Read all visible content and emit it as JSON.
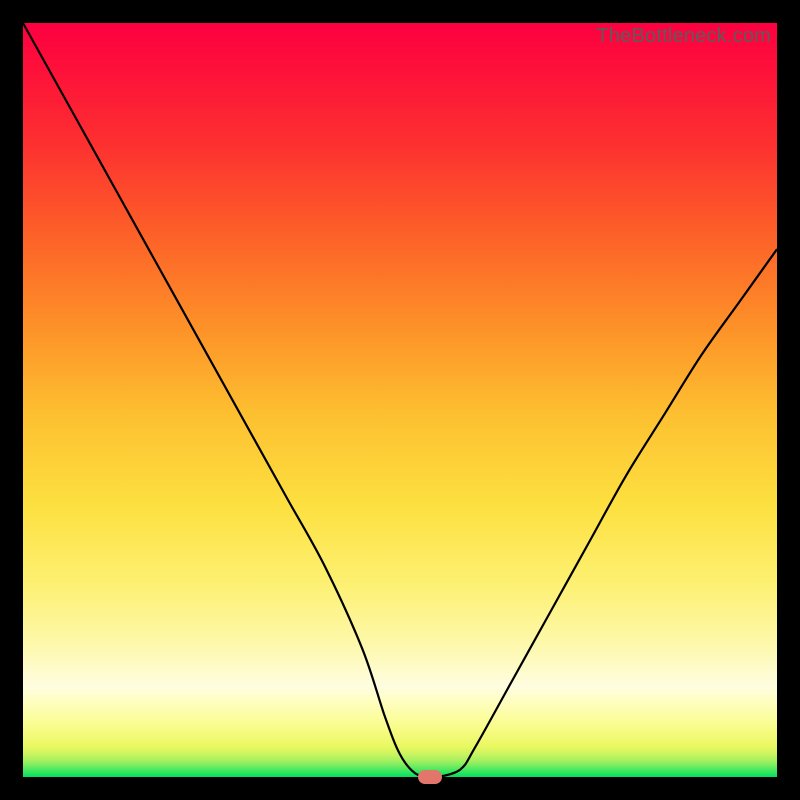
{
  "watermark": "TheBottleneck.com",
  "colors": {
    "frame": "#000000",
    "curve": "#000000",
    "marker": "#e2766a"
  },
  "chart_data": {
    "type": "line",
    "title": "",
    "xlabel": "",
    "ylabel": "",
    "xlim": [
      0,
      100
    ],
    "ylim": [
      0,
      100
    ],
    "grid": false,
    "x": [
      0,
      5,
      10,
      15,
      20,
      25,
      30,
      35,
      40,
      45,
      48,
      50,
      52,
      54,
      55,
      58,
      60,
      65,
      70,
      75,
      80,
      85,
      90,
      95,
      100
    ],
    "values": [
      100,
      91,
      82,
      73,
      64,
      55,
      46,
      37,
      28,
      17,
      8,
      3,
      0.5,
      0,
      0,
      1,
      4,
      13,
      22,
      31,
      40,
      48,
      56,
      63,
      70
    ],
    "marker": {
      "x": 54,
      "y": 0
    },
    "annotations": []
  }
}
